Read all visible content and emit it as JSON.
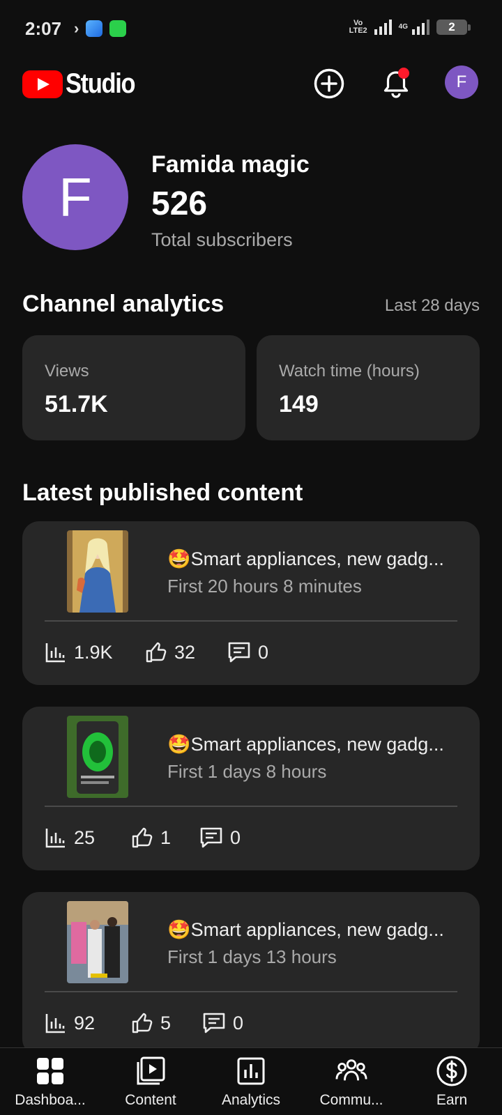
{
  "status_bar": {
    "time": "2:07",
    "volte_top": "Vo",
    "volte_bottom": "LTE2",
    "network_type": "4G",
    "battery_level": "2"
  },
  "app_bar": {
    "logo_text": "Studio",
    "account_initial": "F"
  },
  "channel": {
    "avatar_initial": "F",
    "name": "Famida magic",
    "subscriber_count": "526",
    "subscriber_label": "Total subscribers"
  },
  "analytics": {
    "title": "Channel analytics",
    "range": "Last 28 days",
    "cards": [
      {
        "label": "Views",
        "value": "51.7K"
      },
      {
        "label": "Watch time (hours)",
        "value": "149"
      }
    ]
  },
  "latest": {
    "title": "Latest published content",
    "items": [
      {
        "title": "🤩Smart appliances, new gadg...",
        "subtitle": "First 20 hours 8 minutes",
        "views": "1.9K",
        "likes": "32",
        "comments": "0"
      },
      {
        "title": "🤩Smart appliances, new gadg...",
        "subtitle": "First 1 days 8 hours",
        "views": "25",
        "likes": "1",
        "comments": "0"
      },
      {
        "title": "🤩Smart appliances, new gadg...",
        "subtitle": "First 1 days 13 hours",
        "views": "92",
        "likes": "5",
        "comments": "0"
      }
    ]
  },
  "bottom_nav": [
    {
      "label": "Dashboa...",
      "icon": "dashboard-icon"
    },
    {
      "label": "Content",
      "icon": "content-icon"
    },
    {
      "label": "Analytics",
      "icon": "analytics-icon"
    },
    {
      "label": "Commu...",
      "icon": "community-icon"
    },
    {
      "label": "Earn",
      "icon": "earn-icon"
    }
  ],
  "colors": {
    "background": "#0f0f0f",
    "card": "#272727",
    "brand_red": "#ff0000",
    "avatar_purple": "#7e57c2"
  }
}
